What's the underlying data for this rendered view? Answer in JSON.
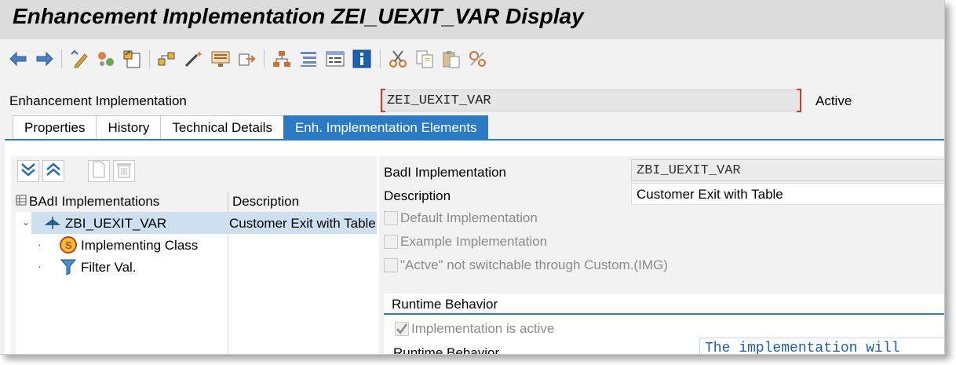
{
  "window": {
    "title": "Enhancement Implementation ZEI_UEXIT_VAR Display"
  },
  "toolbar": {
    "icons": [
      "back-arrow-icon",
      "forward-arrow-icon",
      "display-change-icon",
      "other-object-icon",
      "activate-icon",
      "where-used-icon",
      "magic-wand-icon",
      "screen-icon",
      "navigate-icon",
      "hierarchy-icon",
      "list-icon",
      "details-icon",
      "info-icon",
      "cut-icon",
      "copy-icon",
      "paste-icon",
      "undo-icon"
    ]
  },
  "header": {
    "label": "Enhancement Implementation",
    "value": "ZEI_UEXIT_VAR",
    "status": "Active"
  },
  "tabs": [
    {
      "label": "Properties",
      "active": false
    },
    {
      "label": "History",
      "active": false
    },
    {
      "label": "Technical Details",
      "active": false
    },
    {
      "label": "Enh. Implementation Elements",
      "active": true
    }
  ],
  "tree": {
    "col1_header": "BAdI Implementations",
    "col2_header": "Description",
    "rows": [
      {
        "label": "ZBI_UEXIT_VAR",
        "description": "Customer Exit with Table",
        "icon": "badi-impl-icon",
        "selected": true
      },
      {
        "label": "Implementing Class",
        "description": "",
        "icon": "class-icon",
        "selected": false
      },
      {
        "label": "Filter Val.",
        "description": "",
        "icon": "filter-icon",
        "selected": false
      }
    ]
  },
  "details": {
    "badi_impl_label": "BadI Implementation",
    "badi_impl_value": "ZBI_UEXIT_VAR",
    "description_label": "Description",
    "description_value": "Customer Exit with Table",
    "checkboxes": [
      {
        "label": "Default Implementation",
        "checked": false
      },
      {
        "label": "Example Implementation",
        "checked": false
      },
      {
        "label": "\"Actve\" not switchable through Custom.(IMG)",
        "checked": false
      }
    ],
    "runtime": {
      "title": "Runtime Behavior",
      "active_label": "Implementation is active",
      "active_checked": true,
      "behavior_label": "Runtime Behavior",
      "behavior_value": "The implementation will"
    }
  },
  "colors": {
    "accent": "#2b7bc4",
    "selection": "#cde0f0",
    "required_bracket": "#d43a2a"
  }
}
